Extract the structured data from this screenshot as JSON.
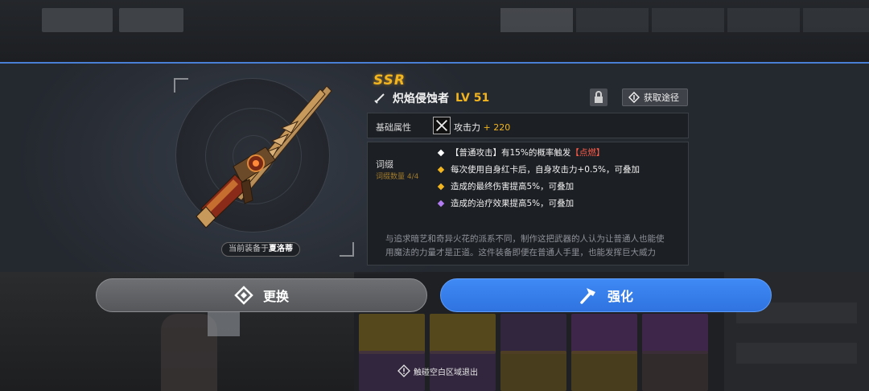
{
  "item": {
    "rarity": "SSR",
    "name": "炽焰侵蚀者",
    "level": "LV 51",
    "equipped_prefix": "当前装备于",
    "equipped_by": "夏洛蒂",
    "source_button": "获取途径"
  },
  "attributes": {
    "label": "基础属性",
    "stat_name": "攻击力",
    "stat_value": "+ 220"
  },
  "affixes": {
    "title": "词缀",
    "count_label": "词缀数量 4/4",
    "lines": [
      {
        "text": "【普通攻击】有15%的概率触发",
        "highlight": "【点燃】",
        "bullet_color": "#ffffff"
      },
      {
        "text": "每次使用自身红卡后，自身攻击力+0.5%，可叠加",
        "bullet_color": "#f2b51f"
      },
      {
        "text": "造成的最终伤害提高5%，可叠加",
        "bullet_color": "#f2b51f"
      },
      {
        "text": "造成的治疗效果提高5%，可叠加",
        "bullet_color": "#b37cf2"
      }
    ],
    "flavor": "与追求暗艺和奇异火花的派系不同，制作这把武器的人认为让普通人也能使用魔法的力量才是正道。这件装备即便在普通人手里，也能发挥巨大威力"
  },
  "actions": {
    "change_label": "更换",
    "upgrade_label": "强化"
  },
  "hint": {
    "exit_text": "触碰空白区域退出"
  },
  "colors": {
    "rarity_gold": "#f2b51f",
    "accent_blue": "#2f73e0",
    "highlight_red": "#ff5c4a"
  }
}
